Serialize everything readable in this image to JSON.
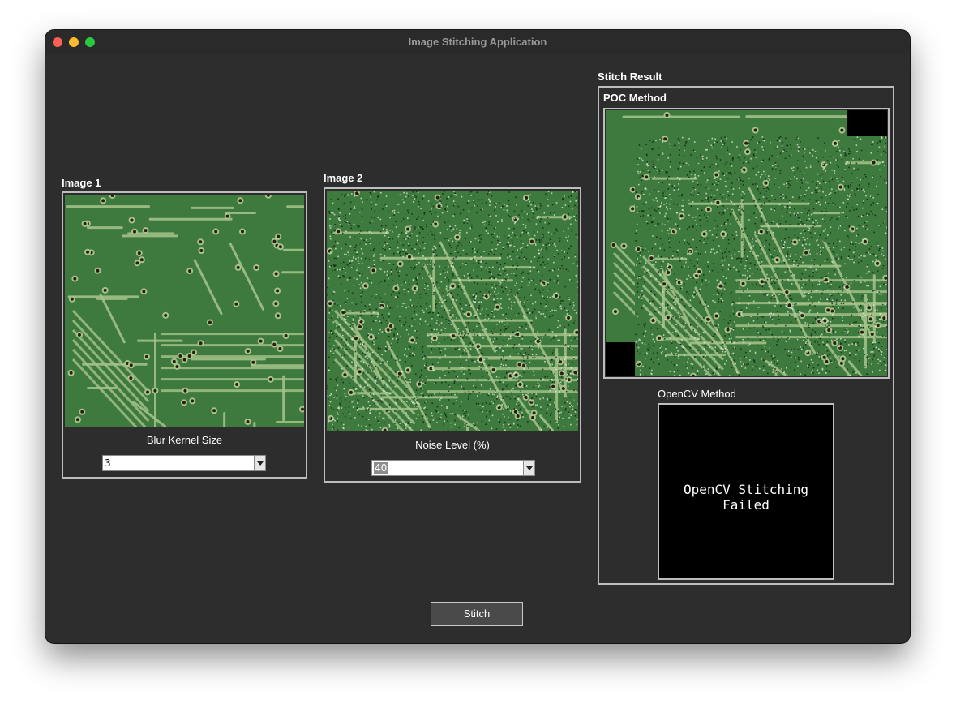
{
  "window": {
    "title": "Image Stitching Application"
  },
  "image1": {
    "label": "Image 1",
    "control_label": "Blur Kernel Size",
    "control_value": "3"
  },
  "image2": {
    "label": "Image 2",
    "control_label": "Noise Level (%)",
    "control_value": "40"
  },
  "result": {
    "label": "Stitch Result",
    "poc_label": "POC Method",
    "opencv_label": "OpenCV Method",
    "opencv_message": "OpenCV Stitching Failed"
  },
  "actions": {
    "stitch_label": "Stitch"
  },
  "colors": {
    "window_bg": "#2d2d2d",
    "pcb_green": "#3e7a3e",
    "trace": "#a8c48c",
    "pad": "#2a1e0e",
    "close": "#fe5f57",
    "minimize": "#febc2e",
    "maximize": "#28c840"
  }
}
